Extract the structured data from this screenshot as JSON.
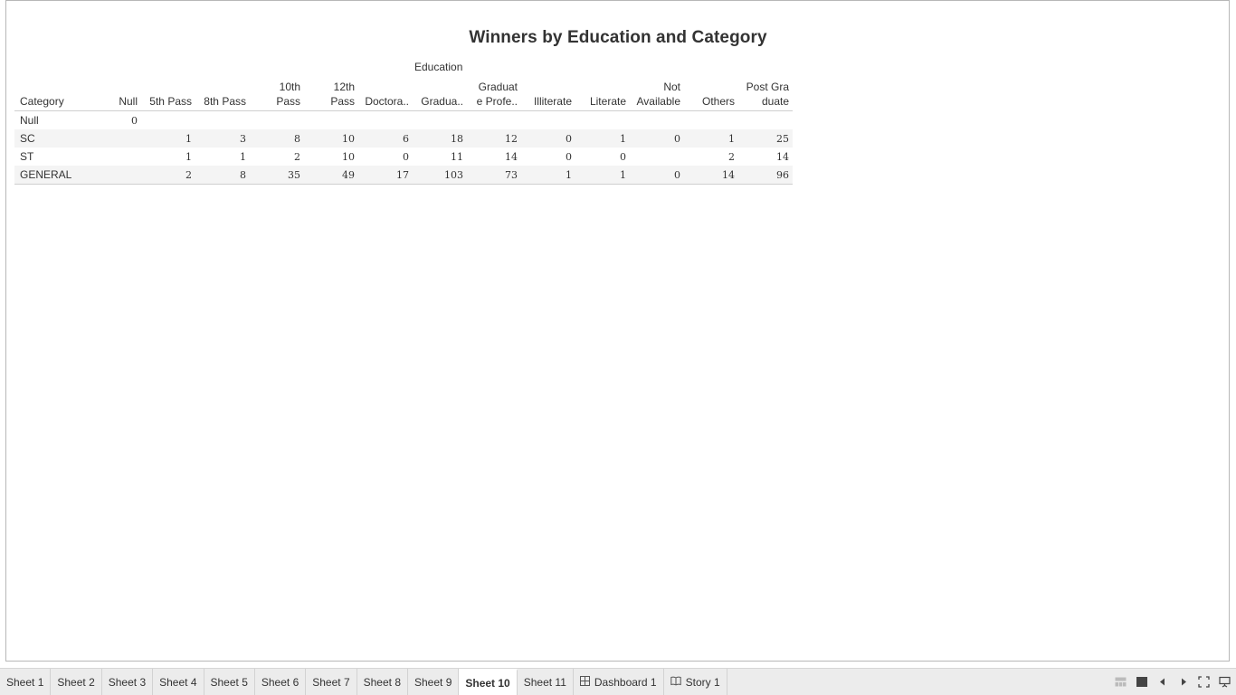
{
  "viz": {
    "title": "Winners by Education and Category",
    "column_group_header": "Education",
    "row_header": "Category",
    "columns": [
      [
        "Null"
      ],
      [
        "5th Pass"
      ],
      [
        "8th Pass"
      ],
      [
        "10th",
        "Pass"
      ],
      [
        "12th",
        "Pass"
      ],
      [
        "Doctora.."
      ],
      [
        "Gradua.."
      ],
      [
        "Graduat",
        "e Profe.."
      ],
      [
        "Illiterate"
      ],
      [
        "Literate"
      ],
      [
        "Not",
        "Available"
      ],
      [
        "Others"
      ],
      [
        "Post Gra",
        "duate"
      ]
    ],
    "rows": [
      {
        "label": "Null",
        "values": [
          "0",
          "",
          "",
          "",
          "",
          "",
          "",
          "",
          "",
          "",
          "",
          "",
          ""
        ]
      },
      {
        "label": "SC",
        "values": [
          "",
          "1",
          "3",
          "8",
          "10",
          "6",
          "18",
          "12",
          "0",
          "1",
          "0",
          "1",
          "25"
        ]
      },
      {
        "label": "ST",
        "values": [
          "",
          "1",
          "1",
          "2",
          "10",
          "0",
          "11",
          "14",
          "0",
          "0",
          "",
          "2",
          "14"
        ]
      },
      {
        "label": "GENERAL",
        "values": [
          "",
          "2",
          "8",
          "35",
          "49",
          "17",
          "103",
          "73",
          "1",
          "1",
          "0",
          "14",
          "96"
        ]
      }
    ]
  },
  "tabs": [
    {
      "label": "Sheet 1",
      "icon": null
    },
    {
      "label": "Sheet 2",
      "icon": null
    },
    {
      "label": "Sheet 3",
      "icon": null
    },
    {
      "label": "Sheet 4",
      "icon": null
    },
    {
      "label": "Sheet 5",
      "icon": null
    },
    {
      "label": "Sheet 6",
      "icon": null
    },
    {
      "label": "Sheet 7",
      "icon": null
    },
    {
      "label": "Sheet 8",
      "icon": null
    },
    {
      "label": "Sheet 9",
      "icon": null
    },
    {
      "label": "Sheet 10",
      "icon": null,
      "active": true
    },
    {
      "label": "Sheet 11",
      "icon": null
    },
    {
      "label": "Dashboard 1",
      "icon": "dashboard-grid-icon"
    },
    {
      "label": "Story 1",
      "icon": "story-book-icon"
    }
  ],
  "colors": {
    "tab_bar_bg": "#ececec",
    "active_tab_bg": "#ffffff",
    "band_row_bg": "#f4f4f4",
    "text": "#333333"
  }
}
